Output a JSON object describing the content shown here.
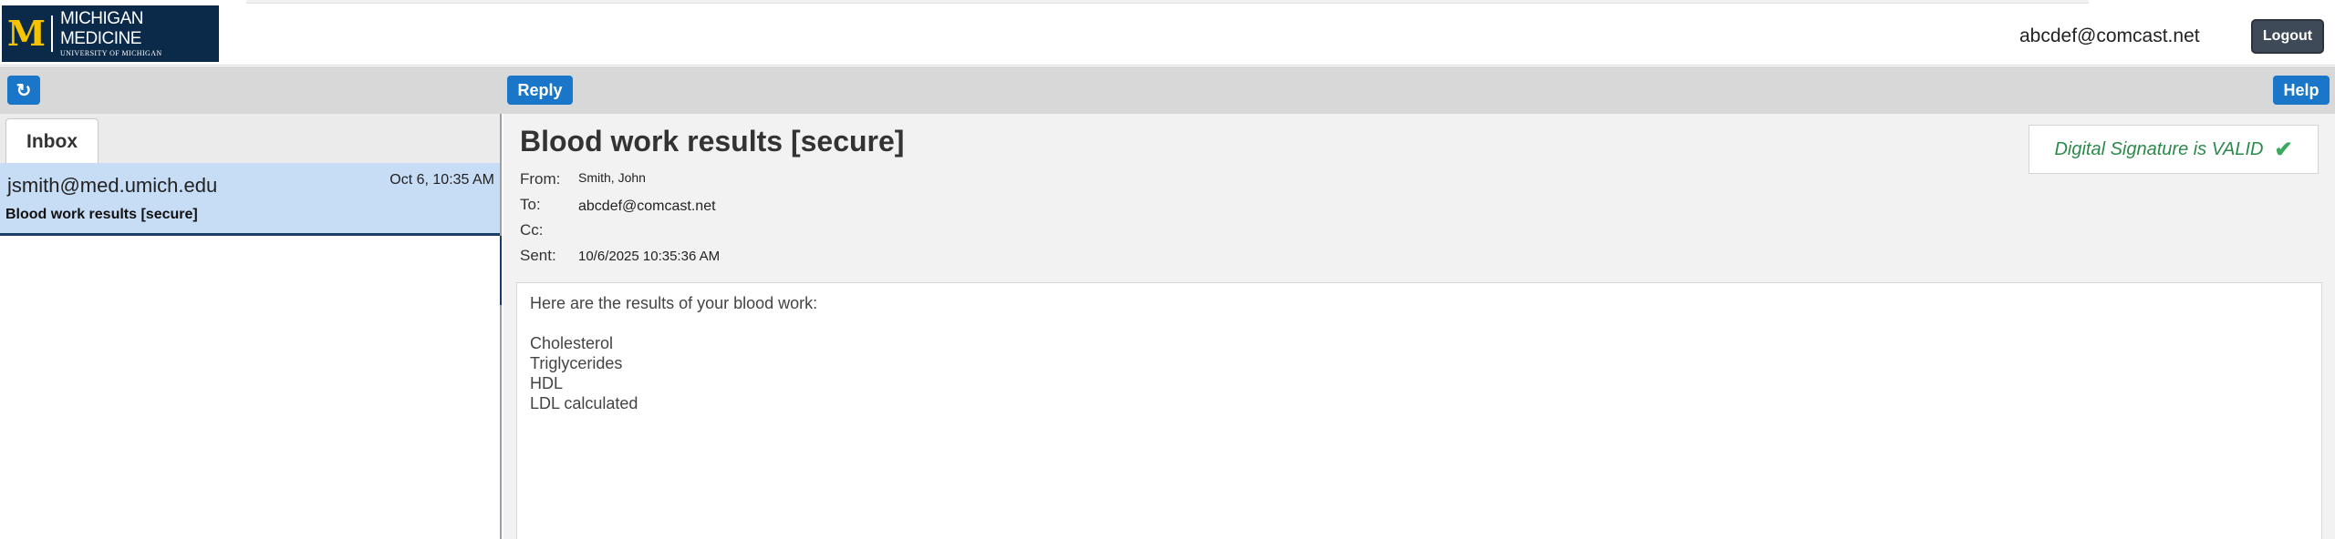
{
  "header": {
    "logo_main": "MICHIGAN MEDICINE",
    "logo_sub": "UNIVERSITY OF MICHIGAN",
    "logo_m": "M",
    "user_email": "abcdef@comcast.net",
    "logout_label": "Logout"
  },
  "toolbar": {
    "refresh_icon": "↻",
    "reply_label": "Reply",
    "help_label": "Help"
  },
  "inbox": {
    "tab_label": "Inbox",
    "messages": [
      {
        "from": "jsmith@med.umich.edu",
        "date": "Oct 6, 10:35 AM",
        "subject": "Blood work results [secure]"
      }
    ]
  },
  "message": {
    "subject": "Blood work results [secure]",
    "from_label": "From:",
    "from_value": "Smith, John",
    "to_label": "To:",
    "to_value": "abcdef@comcast.net",
    "cc_label": "Cc:",
    "cc_value": "",
    "sent_label": "Sent:",
    "sent_value": "10/6/2025 10:35:36 AM",
    "signature_text": "Digital Signature is VALID",
    "signature_icon": "check-icon",
    "body_lines": [
      "Here are the results of your blood work:",
      "Cholesterol",
      "Triglycerides",
      "HDL",
      "LDL calculated"
    ]
  },
  "colors": {
    "accent_button": "#1976c9",
    "logo_bg": "#0b2a4a",
    "logo_gold": "#f6c300",
    "selected_row": "#c7dcf5",
    "signature_green": "#2b8a4b"
  }
}
